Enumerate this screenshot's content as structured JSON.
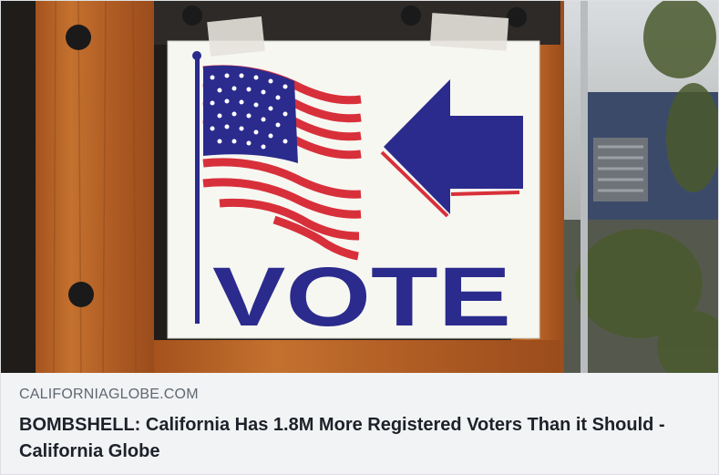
{
  "link_preview": {
    "image": {
      "subject": "sign-vote-arrow-flag",
      "sign_text": "VOTE",
      "colors": {
        "wood": "#b9642a",
        "wood_dark": "#8e4a1c",
        "sign_bg": "#f7f7f2",
        "navy": "#2a2b8c",
        "red": "#d8303a",
        "tape": "#e4e2da"
      }
    },
    "domain": "CALIFORNIAGLOBE.COM",
    "headline": "BOMBSHELL: California Has 1.8M More Registered Voters Than it Should - California Globe"
  }
}
